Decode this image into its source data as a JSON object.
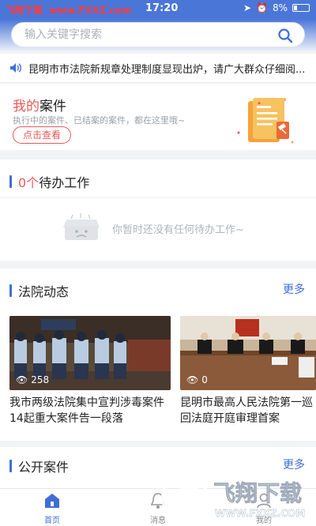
{
  "status_bar": {
    "brand": "飞翔下载",
    "url": "www.FXXZ.com",
    "time": "17:20",
    "battery": "8%"
  },
  "search": {
    "placeholder": "输入关键字搜索"
  },
  "notice": {
    "text": "昆明市市法院新规章处理制度显现出炉，请广大群众仔细阅..."
  },
  "my_cases": {
    "title_highlight": "我的",
    "title_rest": "案件",
    "desc": "执行中的案件、已结案的案件，都在这里哦~",
    "button": "点击查看"
  },
  "pending": {
    "count": "0个",
    "title": "待办工作",
    "empty_text": "你暂时还没有任何待办工作~"
  },
  "court_news": {
    "title": "法院动态",
    "more": "更多",
    "items": [
      {
        "views": "258",
        "title": "我市两级法院集中宣判涉毒案件14起重大案件告一段落"
      },
      {
        "views": "0",
        "title": "昆明市最高人民法院第一巡回法庭开庭审理首案"
      }
    ]
  },
  "public_cases": {
    "title": "公开案件",
    "more": "更多"
  },
  "tabbar": {
    "items": [
      {
        "label": "首页",
        "active": true
      },
      {
        "label": "消息",
        "active": false
      },
      {
        "label": "我的",
        "active": false
      }
    ]
  },
  "watermark": {
    "cn": "飞翔下载",
    "url": "WWW.FXXZ.COM"
  },
  "colors": {
    "primary": "#3f6fd6",
    "accent": "#e85a5a",
    "status_bar": "#4a76d8"
  }
}
